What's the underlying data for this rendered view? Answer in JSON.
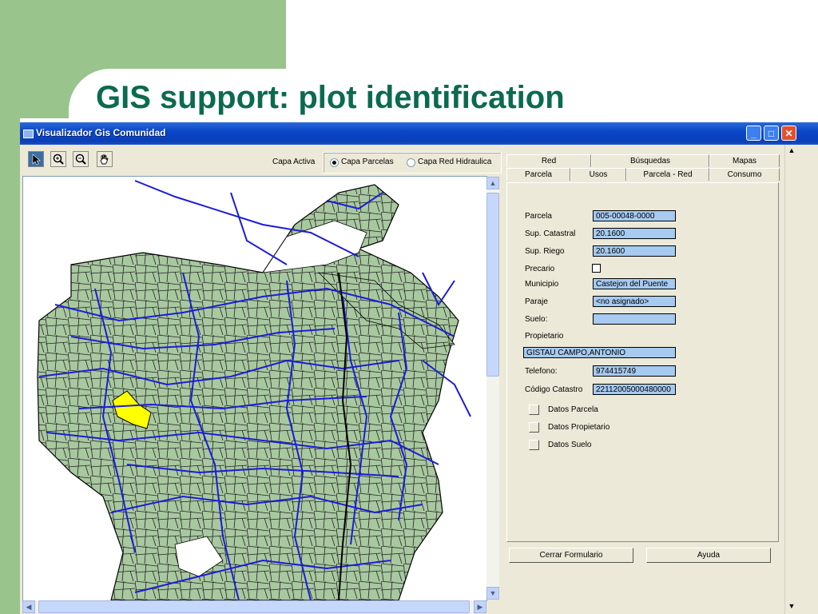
{
  "slide": {
    "title": "GIS support: plot identification"
  },
  "window": {
    "title": "Visualizador Gis Comunidad",
    "min": "_",
    "max": "□",
    "close": "✕"
  },
  "toolbar": {
    "tools": [
      "select-arrow-icon",
      "zoom-in-icon",
      "zoom-out-icon",
      "pan-hand-icon"
    ],
    "capa_label": "Capa Activa",
    "radio_parcelas": "Capa Parcelas",
    "radio_red": "Capa Red Hidraulica",
    "selected": "Capa Parcelas"
  },
  "tabs": {
    "row_back": [
      "Red",
      "Búsquedas",
      "Mapas"
    ],
    "row_front": [
      "Parcela",
      "Usos",
      "Parcela - Red",
      "Consumo"
    ],
    "active": "Parcela"
  },
  "form": {
    "parcela_label": "Parcela",
    "parcela": "005-00048-0000",
    "sup_catastral_label": "Sup. Catastral",
    "sup_catastral": "20.1600",
    "sup_riego_label": "Sup. Riego",
    "sup_riego": "20.1600",
    "precario_label": "Precario",
    "precario_checked": false,
    "municipio_label": "Municipio",
    "municipio": "Castejon del Puente",
    "paraje_label": "Paraje",
    "paraje": "<no asignado>",
    "suelo_label": "Suelo:",
    "suelo": "",
    "propietario_label": "Propietario",
    "propietario": "GISTAU CAMPO,ANTONIO",
    "telefono_label": "Telefono:",
    "telefono": "974415749",
    "codigo_label": "Código Catastro",
    "codigo": "22112005000480000",
    "datos_parcela": "Datos Parcela",
    "datos_propietario": "Datos Propietario",
    "datos_suelo": "Datos Suelo"
  },
  "buttons": {
    "cerrar": "Cerrar Formulario",
    "ayuda": "Ayuda"
  },
  "map": {
    "parcel_fill": "#a8c8a0",
    "network_color": "#1c1cd8",
    "selected_color": "#ffff00"
  }
}
